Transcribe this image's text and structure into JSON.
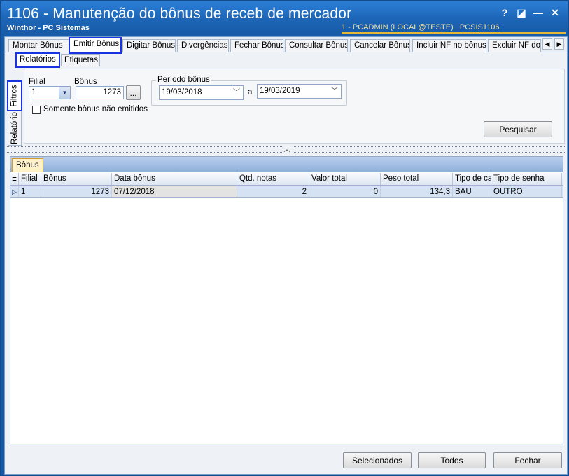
{
  "window": {
    "title": "1106 - Manutenção do bônus de receb de mercador",
    "subtitle": "Winthor - PC Sistemas",
    "user_info": "1 - PCADMIN (LOCAL@TESTE)",
    "program": "PCSIS1106",
    "controls": {
      "help": "?",
      "restore": "◪",
      "minimize": "—",
      "close": "✕"
    }
  },
  "tabs": [
    {
      "label": "Montar Bônus"
    },
    {
      "label": "Emitir Bônus"
    },
    {
      "label": "Digitar Bônus"
    },
    {
      "label": "Divergências"
    },
    {
      "label": "Fechar Bônus"
    },
    {
      "label": "Consultar Bônus"
    },
    {
      "label": "Cancelar Bônus"
    },
    {
      "label": "Incluir NF no bônus"
    },
    {
      "label": "Excluir NF do bônus"
    }
  ],
  "active_tab": "Emitir Bônus",
  "subtabs": [
    {
      "label": "Relatórios"
    },
    {
      "label": "Etiquetas"
    }
  ],
  "vertical_tabs": [
    {
      "label": "Filtros"
    },
    {
      "label": "Relatório"
    }
  ],
  "filters": {
    "filial_label": "Filial",
    "filial_value": "1",
    "bonus_label": "Bônus",
    "bonus_value": "1273",
    "bonus_lookup": "...",
    "periodo_label": "Período bônus",
    "date_from": "19/03/2018",
    "date_sep": "a",
    "date_to": "19/03/2019",
    "checkbox_label": "Somente bônus não emitidos",
    "search_button": "Pesquisar"
  },
  "grid": {
    "tab_label": "Bônus",
    "columns": [
      "Filial",
      "Bônus",
      "Data bônus",
      "Qtd. notas",
      "Valor total",
      "Peso total",
      "Tipo de ca",
      "Tipo de senha"
    ],
    "rows": [
      [
        "1",
        "1273",
        "07/12/2018",
        "2",
        "0",
        "134,3",
        "BAU",
        "OUTRO"
      ]
    ]
  },
  "footer": {
    "selected_button": "Selecionados",
    "all_button": "Todos",
    "close_button": "Fechar"
  },
  "colors": {
    "title_bar": "#1d66b8",
    "highlight_outline": "#1a33e0",
    "selected_row": "#d5e2f3"
  }
}
